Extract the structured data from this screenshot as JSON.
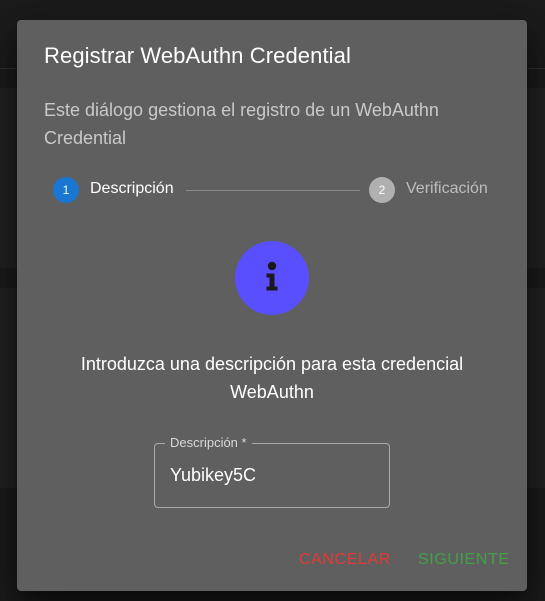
{
  "dialog": {
    "title": "Registrar WebAuthn Credential",
    "subtitle": "Este diálogo gestiona el registro de un WebAuthn Credential",
    "stepper": {
      "active_step": 1,
      "steps": [
        {
          "number": "1",
          "label": "Descripción",
          "state": "active",
          "color": "#1976d2"
        },
        {
          "number": "2",
          "label": "Verificación",
          "state": "inactive",
          "color": "#b0b0b0"
        }
      ]
    },
    "icon": {
      "name": "info-icon",
      "color": "#5a4fff"
    },
    "prompt": "Introduzca una descripción para esta credencial WebAuthn",
    "description_field": {
      "label": "Descripción *",
      "value": "Yubikey5C"
    },
    "actions": {
      "cancel_label": "CANCELAR",
      "cancel_color": "#e53935",
      "next_label": "SIGUIENTE",
      "next_color": "#43a047"
    }
  }
}
